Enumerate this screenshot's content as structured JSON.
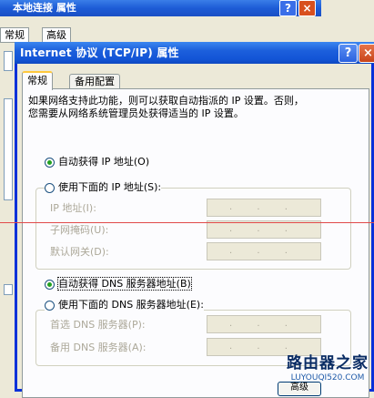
{
  "background_window": {
    "title": "本地连接 属性",
    "tabs": [
      "常规",
      "高级"
    ],
    "help_glyph": "?",
    "close_glyph": "×"
  },
  "dialog": {
    "title": "Internet 协议 (TCP/IP) 属性",
    "help_glyph": "?",
    "close_glyph": "×",
    "tabs": [
      {
        "label": "常规",
        "active": true
      },
      {
        "label": "备用配置",
        "active": false
      }
    ],
    "description_lines": [
      "如果网络支持此功能，则可以获取自动指派的 IP 设置。否则，",
      "您需要从网络系统管理员处获得适当的 IP 设置。"
    ],
    "ip": {
      "auto_label": "自动获得 IP 地址(O)",
      "manual_label": "使用下面的 IP 地址(S):",
      "auto_selected": true,
      "fields": [
        {
          "label": "IP 地址(I):",
          "value": ". . ."
        },
        {
          "label": "子网掩码(U):",
          "value": ". . ."
        },
        {
          "label": "默认网关(D):",
          "value": ". . ."
        }
      ]
    },
    "dns": {
      "auto_label": "自动获得 DNS 服务器地址(B)",
      "manual_label": "使用下面的 DNS 服务器地址(E):",
      "auto_selected": true,
      "fields": [
        {
          "label": "首选 DNS 服务器(P):",
          "value": ". . ."
        },
        {
          "label": "备用 DNS 服务器(A):",
          "value": ". . ."
        }
      ]
    },
    "footer_button_label": "高级"
  },
  "watermark": {
    "name": "路由器之家",
    "url": "LUYOUQI520.COM"
  },
  "colors": {
    "title_bar": "#1c5fdc",
    "dialog_bg": "#ece9d8",
    "radio_selected": "#21a121",
    "disabled_text": "#aca899",
    "guide_line": "#e14a4a"
  }
}
